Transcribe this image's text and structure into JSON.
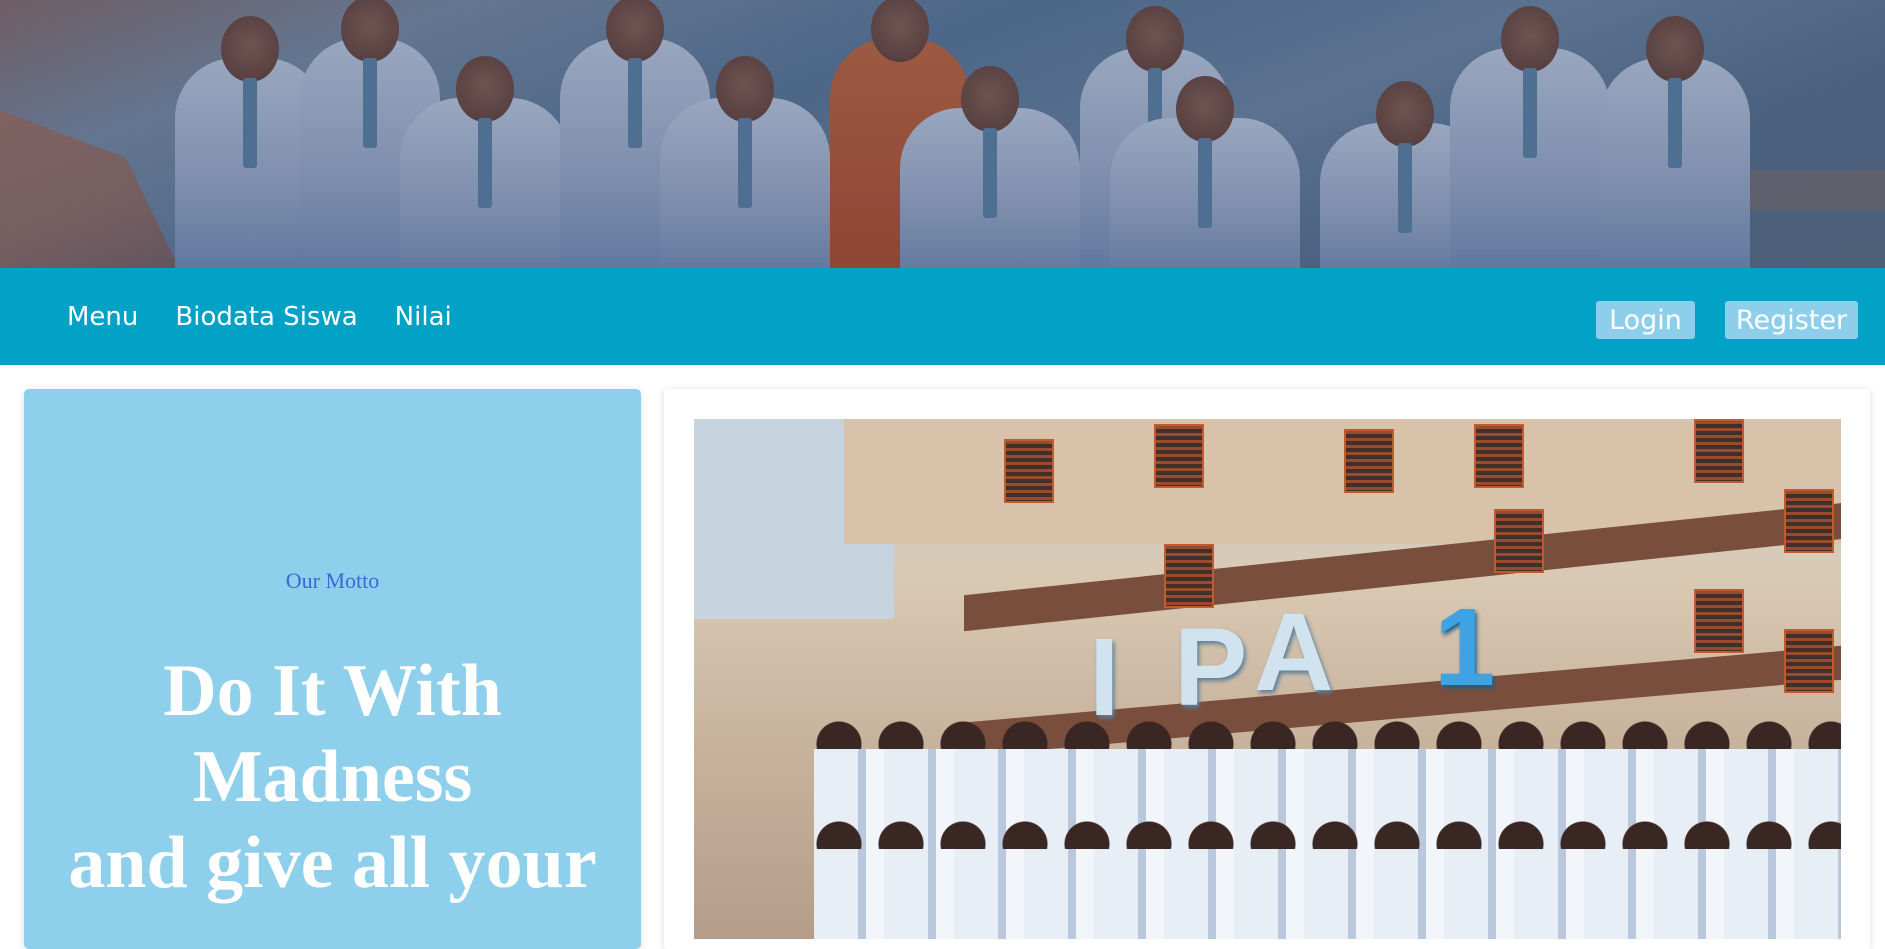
{
  "nav": {
    "links": [
      "Menu",
      "Biodata Siswa",
      "Nilai"
    ],
    "login_label": "Login",
    "register_label": "Register"
  },
  "colors": {
    "navbar": "#02a2c7",
    "nav_button": "#8dcfeb",
    "motto_card": "#8ecfec",
    "motto_label": "#3a68d6"
  },
  "hero": {
    "image": "students-group-photo"
  },
  "motto": {
    "label": "Our Motto",
    "lines": [
      "Do It With",
      "Madness",
      "and give all your"
    ]
  },
  "gallery": {
    "image": "class-photo-ipa-1",
    "balloon_letters": [
      "I",
      "P",
      "A",
      "1"
    ]
  }
}
